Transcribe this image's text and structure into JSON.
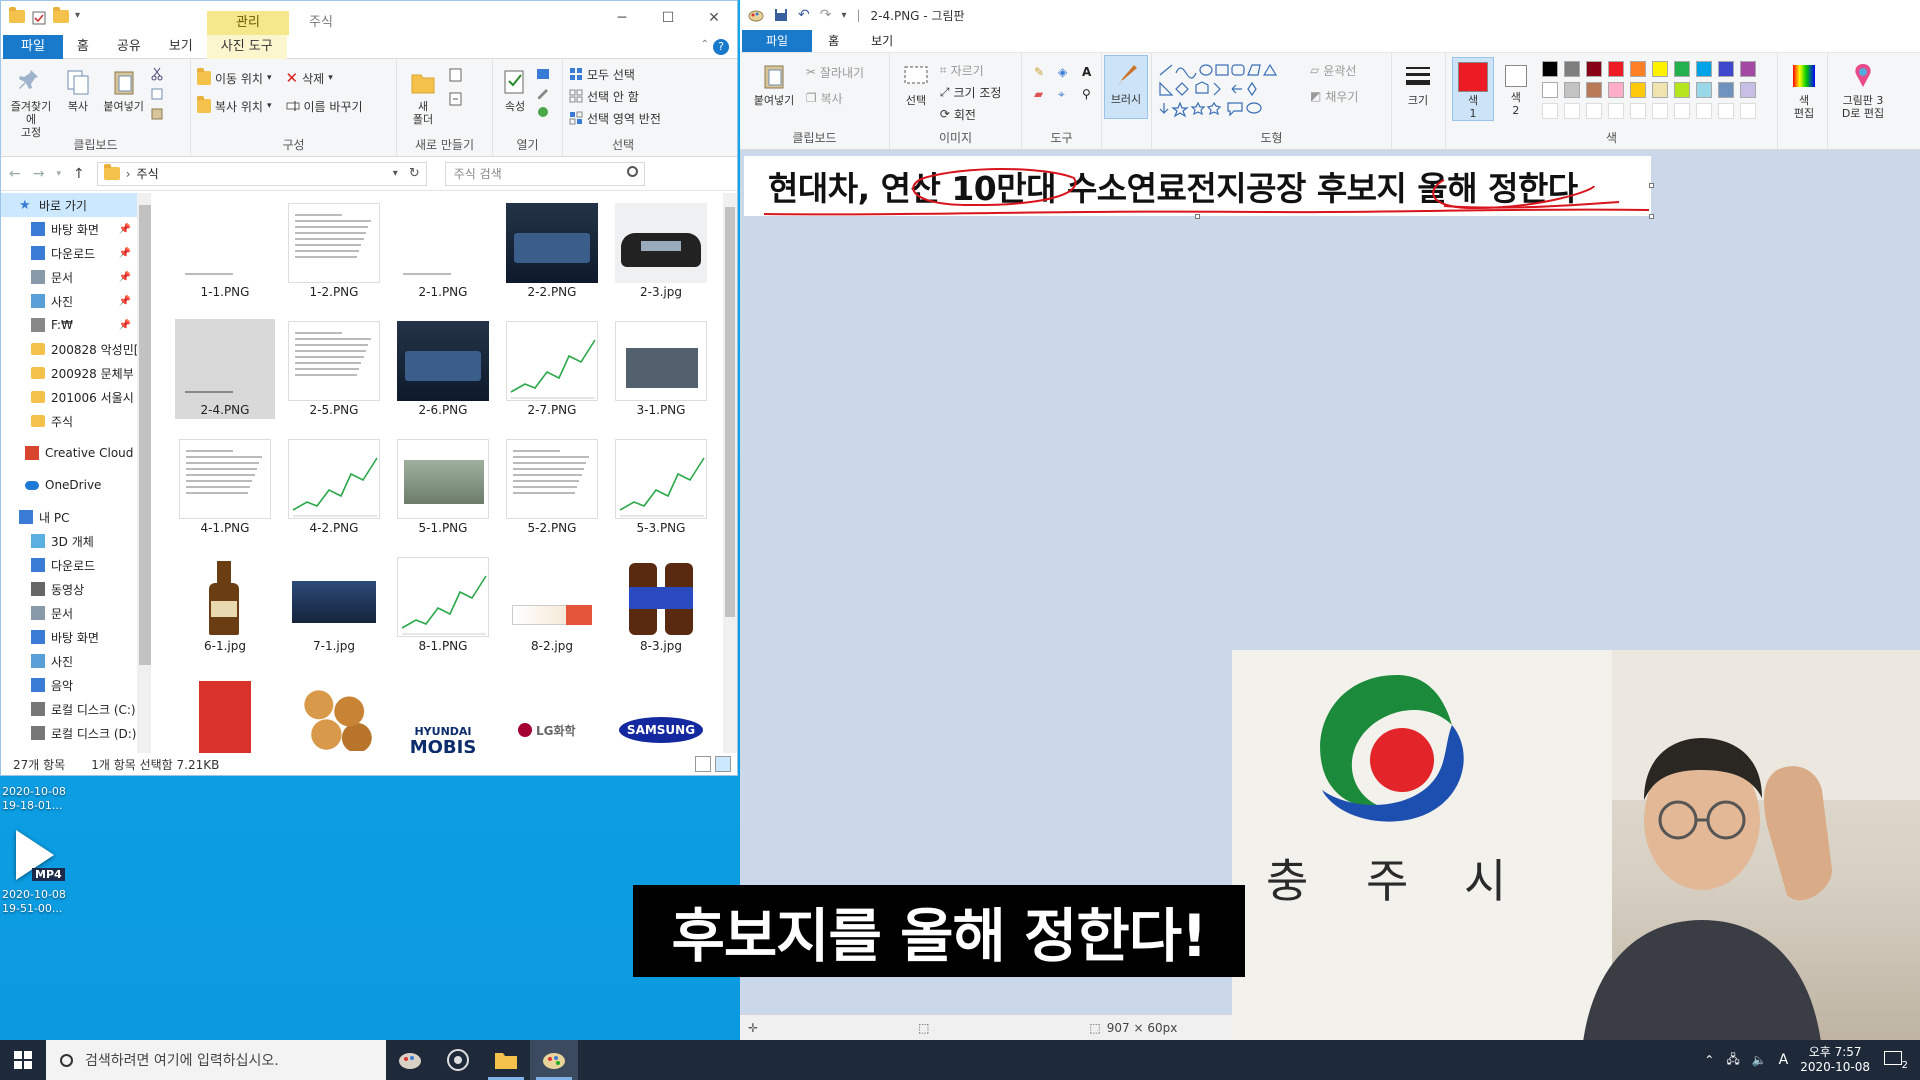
{
  "explorer": {
    "context_tab": "관리",
    "window_name": "주식",
    "tabs": [
      "파일",
      "홈",
      "공유",
      "보기",
      "사진 도구"
    ],
    "ribbon": {
      "clipboard": {
        "label": "클립보드",
        "pin": "즐겨찾기에\n고정",
        "copy": "복사",
        "paste": "붙여넣기"
      },
      "organize": {
        "label": "구성",
        "move": "이동 위치",
        "copy_to": "복사 위치",
        "delete": "삭제",
        "rename": "이름 바꾸기"
      },
      "new": {
        "label": "새로 만들기",
        "new_folder": "새\n폴더"
      },
      "open": {
        "label": "열기",
        "properties": "속성"
      },
      "select": {
        "label": "선택",
        "all": "모두 선택",
        "none": "선택 안 함",
        "invert": "선택 영역 반전"
      }
    },
    "address": "주식",
    "search_placeholder": "주식 검색",
    "nav": [
      {
        "label": "바로 가기",
        "type": "star"
      },
      {
        "label": "바탕 화면",
        "type": "desktop",
        "pin": true
      },
      {
        "label": "다운로드",
        "type": "down",
        "pin": true
      },
      {
        "label": "문서",
        "type": "doc",
        "pin": true
      },
      {
        "label": "사진",
        "type": "pic",
        "pin": true
      },
      {
        "label": "F:₩",
        "type": "drive",
        "pin": true
      },
      {
        "label": "200828 악성민[",
        "type": "folder"
      },
      {
        "label": "200928 문체부",
        "type": "folder"
      },
      {
        "label": "201006 서울시",
        "type": "folder"
      },
      {
        "label": "주식",
        "type": "folder"
      },
      {
        "label": "",
        "type": "gap"
      },
      {
        "label": "Creative Cloud Fil",
        "type": "cc"
      },
      {
        "label": "",
        "type": "gap"
      },
      {
        "label": "OneDrive",
        "type": "cloud"
      },
      {
        "label": "",
        "type": "gap"
      },
      {
        "label": "내 PC",
        "type": "pc"
      },
      {
        "label": "3D 개체",
        "type": "cube"
      },
      {
        "label": "다운로드",
        "type": "down"
      },
      {
        "label": "동영상",
        "type": "video"
      },
      {
        "label": "문서",
        "type": "doc"
      },
      {
        "label": "바탕 화면",
        "type": "desktop"
      },
      {
        "label": "사진",
        "type": "pic"
      },
      {
        "label": "음악",
        "type": "music"
      },
      {
        "label": "로컬 디스크 (C:)",
        "type": "disk"
      },
      {
        "label": "로컬 디스크 (D:)",
        "type": "disk"
      }
    ],
    "files": [
      {
        "name": "1-1.PNG",
        "kind": "line"
      },
      {
        "name": "1-2.PNG",
        "kind": "doc"
      },
      {
        "name": "2-1.PNG",
        "kind": "line"
      },
      {
        "name": "2-2.PNG",
        "kind": "photo"
      },
      {
        "name": "2-3.jpg",
        "kind": "car"
      },
      {
        "name": "2-4.PNG",
        "kind": "selected"
      },
      {
        "name": "2-5.PNG",
        "kind": "doc"
      },
      {
        "name": "2-6.PNG",
        "kind": "photo"
      },
      {
        "name": "2-7.PNG",
        "kind": "chart"
      },
      {
        "name": "3-1.PNG",
        "kind": "news"
      },
      {
        "name": "4-1.PNG",
        "kind": "doc"
      },
      {
        "name": "4-2.PNG",
        "kind": "chart"
      },
      {
        "name": "5-1.PNG",
        "kind": "factory"
      },
      {
        "name": "5-2.PNG",
        "kind": "doc"
      },
      {
        "name": "5-3.PNG",
        "kind": "chart"
      },
      {
        "name": "6-1.jpg",
        "kind": "bottle"
      },
      {
        "name": "7-1.jpg",
        "kind": "meeting"
      },
      {
        "name": "8-1.PNG",
        "kind": "chart"
      },
      {
        "name": "8-2.jpg",
        "kind": "tube"
      },
      {
        "name": "8-3.jpg",
        "kind": "bottles"
      },
      {
        "name": "",
        "kind": "snack"
      },
      {
        "name": "",
        "kind": "bread"
      },
      {
        "name": "",
        "kind": "mobis"
      },
      {
        "name": "",
        "kind": "lg"
      },
      {
        "name": "",
        "kind": "samsung"
      }
    ],
    "logo_texts": {
      "mobis_a": "HYUNDAI",
      "mobis_b": "MOBIS",
      "lg": "LG화학",
      "samsung": "SAMSUNG"
    },
    "status": {
      "count": "27개 항목",
      "selection": "1개 항목 선택함 7.21KB"
    }
  },
  "desktop": {
    "file1": {
      "date": "2020-10-08",
      "time": "19-18-01..."
    },
    "file2": {
      "tag": "MP4",
      "date": "2020-10-08",
      "time": "19-51-00..."
    }
  },
  "paint": {
    "title": "2-4.PNG - 그림판",
    "tabs": [
      "파일",
      "홈",
      "보기"
    ],
    "ribbon": {
      "clipboard": {
        "label": "클립보드",
        "paste": "붙여넣기",
        "cut": "잘라내기",
        "copy": "복사"
      },
      "image": {
        "label": "이미지",
        "select": "선택",
        "crop": "자르기",
        "resize": "크기 조정",
        "rotate": "회전"
      },
      "tools": {
        "label": "도구"
      },
      "brush": "브러시",
      "shapes": {
        "label": "도형",
        "outline": "윤곽선",
        "fill": "채우기"
      },
      "size": "크기",
      "color1": "색\n1",
      "color2": "색\n2",
      "colors_label": "색",
      "edit_colors": "색\n편집",
      "paint3d": "그림판 3\nD로 편집"
    },
    "palette_colors": [
      "#000000",
      "#7f7f7f",
      "#880015",
      "#ed1c24",
      "#ff7f27",
      "#fff200",
      "#22b14c",
      "#00a2e8",
      "#3f48cc",
      "#a349a4",
      "#ffffff",
      "#c3c3c3",
      "#b97a57",
      "#ffaec9",
      "#ffc90e",
      "#efe4b0",
      "#b5e61d",
      "#99d9ea",
      "#7092be",
      "#c8bfe7"
    ],
    "color1": "#ed1c24",
    "headline": "현대차, 연산 10만대 수소연료전지공장 후보지 올해 정한다",
    "dimensions": "907 × 60px"
  },
  "webcam": {
    "logo_chars": [
      "충",
      "주",
      "시"
    ]
  },
  "subtitle": "후보지를 올해 정한다!",
  "taskbar": {
    "search_placeholder": "검색하려면 여기에 입력하십시오.",
    "time": "오후 7:57",
    "date": "2020-10-08",
    "ime": "A",
    "notif_count": "2"
  }
}
